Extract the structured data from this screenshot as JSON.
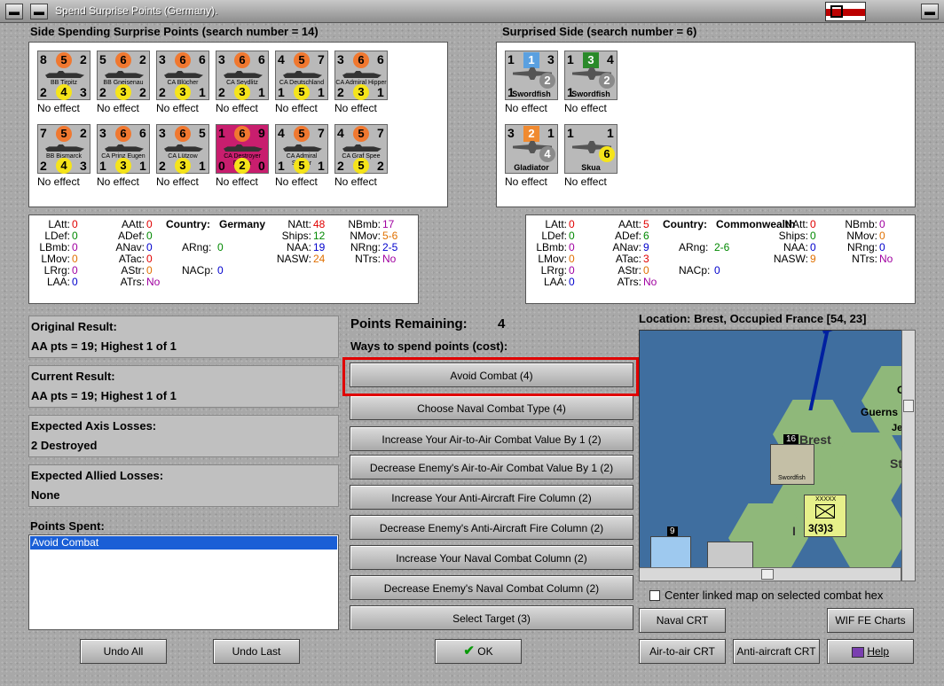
{
  "window": {
    "title": "Spend Surprise Points (Germany)."
  },
  "left_header": "Side Spending Surprise Points (search number = 14)",
  "right_header": "Surprised Side (search number = 6)",
  "left_units": [
    {
      "name": "BB Tirpitz",
      "tl": "8",
      "tc": "5",
      "tr": "2",
      "bl": "2",
      "bc": "4",
      "br": "3",
      "effect": "No effect"
    },
    {
      "name": "BB Gneisenau",
      "tl": "5",
      "tc": "6",
      "tr": "2",
      "bl": "2",
      "bc": "3",
      "br": "2",
      "effect": "No effect"
    },
    {
      "name": "CA Blücher",
      "tl": "3",
      "tc": "6",
      "tr": "6",
      "bl": "2",
      "bc": "3",
      "br": "1",
      "effect": "No effect"
    },
    {
      "name": "CA Seydlitz",
      "tl": "3",
      "tc": "6",
      "tr": "6",
      "bl": "2",
      "bc": "3",
      "br": "1",
      "effect": "No effect"
    },
    {
      "name": "CA Deutschland",
      "tl": "4",
      "tc": "5",
      "tr": "7",
      "bl": "1",
      "bc": "5",
      "br": "1",
      "effect": "No effect"
    },
    {
      "name": "CA Admiral Hipper",
      "tl": "3",
      "tc": "6",
      "tr": "6",
      "bl": "2",
      "bc": "3",
      "br": "1",
      "effect": "No effect"
    },
    {
      "name": "BB Bismarck",
      "tl": "7",
      "tc": "5",
      "tr": "2",
      "bl": "2",
      "bc": "4",
      "br": "3",
      "effect": "No effect"
    },
    {
      "name": "CA Prinz Eugen",
      "tl": "3",
      "tc": "6",
      "tr": "6",
      "bl": "1",
      "bc": "3",
      "br": "1",
      "effect": "No effect"
    },
    {
      "name": "CA Lützow",
      "tl": "3",
      "tc": "6",
      "tr": "5",
      "bl": "2",
      "bc": "3",
      "br": "1",
      "effect": "No effect"
    },
    {
      "name": "CA Destroyer Flotilla",
      "tl": "1",
      "tc": "6",
      "tr": "9",
      "bl": "0",
      "bc": "2",
      "br": "0",
      "effect": "No effect",
      "color": "#c81e6e"
    },
    {
      "name": "CA Admiral Scheer",
      "tl": "4",
      "tc": "5",
      "tr": "7",
      "bl": "1",
      "bc": "5",
      "br": "1",
      "effect": "No effect"
    },
    {
      "name": "CA Graf Spee",
      "tl": "4",
      "tc": "5",
      "tr": "7",
      "bl": "2",
      "bc": "5",
      "br": "2",
      "effect": "No effect"
    }
  ],
  "right_units": [
    {
      "name": "Swordfish",
      "tl": "1",
      "tc": "1",
      "tr": "3",
      "bl": "1",
      "bc": "2",
      "br": "",
      "effect": "No effect",
      "tc_color": "#5aa0e0"
    },
    {
      "name": "Swordfish",
      "tl": "1",
      "tc": "3",
      "tr": "4",
      "bl": "1",
      "bc": "2",
      "br": "",
      "effect": "No effect",
      "tc_color": "#2a8a2a"
    },
    {
      "name": "Gladiator",
      "tl": "3",
      "tc": "2",
      "tr": "1",
      "bl": "",
      "bc": "4",
      "br": "",
      "effect": "No effect",
      "tc_color": "#f08a30"
    },
    {
      "name": "Skua",
      "tl": "1",
      "tc": "",
      "tr": "1",
      "bl": "",
      "bc": "6",
      "br": "",
      "effect": "No effect",
      "tc_color": ""
    }
  ],
  "left_stats": {
    "country_label": "Country:",
    "country": "Germany",
    "rows": [
      [
        [
          "LAtt:",
          "0"
        ],
        [
          "AAtt:",
          "0"
        ],
        [
          "NAtt:",
          "48"
        ],
        [
          "NBmb:",
          "17"
        ]
      ],
      [
        [
          "LDef:",
          "0"
        ],
        [
          "ADef:",
          "0"
        ],
        [
          "Ships:",
          "12"
        ],
        [
          "NMov:",
          "5-6"
        ]
      ],
      [
        [
          "LBmb:",
          "0"
        ],
        [
          "ANav:",
          "0"
        ],
        [
          "NAA:",
          "19"
        ],
        [
          "NRng:",
          "2-5"
        ]
      ],
      [
        [
          "LMov:",
          "0"
        ],
        [
          "ATac:",
          "0"
        ],
        [
          "NASW:",
          "24"
        ],
        [
          "NTrs:",
          "No"
        ]
      ],
      [
        [
          "LRrg:",
          "0"
        ],
        [
          "AStr:",
          "0"
        ]
      ],
      [
        [
          "LAA:",
          "0"
        ],
        [
          "ATrs:",
          "No"
        ]
      ]
    ],
    "arng": [
      "ARng:",
      "0"
    ],
    "nacp": [
      "NACp:",
      "0"
    ]
  },
  "right_stats": {
    "country_label": "Country:",
    "country": "Commonwealth",
    "rows": [
      [
        [
          "LAtt:",
          "0"
        ],
        [
          "AAtt:",
          "5"
        ],
        [
          "NAtt:",
          "0"
        ],
        [
          "NBmb:",
          "0"
        ]
      ],
      [
        [
          "LDef:",
          "0"
        ],
        [
          "ADef:",
          "6"
        ],
        [
          "Ships:",
          "0"
        ],
        [
          "NMov:",
          "0"
        ]
      ],
      [
        [
          "LBmb:",
          "0"
        ],
        [
          "ANav:",
          "9"
        ],
        [
          "NAA:",
          "0"
        ],
        [
          "NRng:",
          "0"
        ]
      ],
      [
        [
          "LMov:",
          "0"
        ],
        [
          "ATac:",
          "3"
        ],
        [
          "NASW:",
          "9"
        ],
        [
          "NTrs:",
          "No"
        ]
      ],
      [
        [
          "LRrg:",
          "0"
        ],
        [
          "AStr:",
          "0"
        ]
      ],
      [
        [
          "LAA:",
          "0"
        ],
        [
          "ATrs:",
          "No"
        ]
      ]
    ],
    "arng": [
      "ARng:",
      "2-6"
    ],
    "nacp": [
      "NACp:",
      "0"
    ]
  },
  "results": {
    "original_label": "Original Result:",
    "original_value": "AA pts = 19; Highest 1 of 1",
    "current_label": "Current Result:",
    "current_value": "AA pts = 19; Highest 1 of 1",
    "axis_label": "Expected Axis Losses:",
    "axis_value": "2 Destroyed",
    "allied_label": "Expected Allied Losses:",
    "allied_value": "None",
    "spent_label": "Points Spent:",
    "spent_items": [
      "Avoid Combat"
    ]
  },
  "points": {
    "label": "Points Remaining:",
    "value": "4",
    "ways_label": "Ways to spend points (cost):"
  },
  "options": [
    "Avoid Combat (4)",
    "Choose Naval Combat Type (4)",
    "Increase Your Air-to-Air Combat Value By 1 (2)",
    "Decrease Enemy's Air-to-Air Combat Value By 1 (2)",
    "Increase Your Anti-Aircraft Fire Column (2)",
    "Decrease Enemy's Anti-Aircraft Fire Column (2)",
    "Increase Your Naval Combat Column (2)",
    "Decrease Enemy's Naval Combat Column (2)",
    "Select Target (3)"
  ],
  "location": {
    "label": "Location: Brest, Occupied France [54, 23]",
    "map_labels": {
      "brest": "Brest",
      "guerns": "Guerns",
      "je": "Je",
      "st": "St",
      "i": "I",
      "c": "C",
      "hexnum": "16",
      "stack": "9",
      "corps": "XXXXX",
      "corps_val": "3(3)3",
      "swordfish": "Swordfish"
    }
  },
  "checkbox_label": "Center linked map on selected combat hex",
  "buttons": {
    "undo_all": "Undo All",
    "undo_last": "Undo Last",
    "ok": "OK",
    "naval_crt": "Naval CRT",
    "wif_charts": "WIF FE Charts",
    "air_crt": "Air-to-air CRT",
    "aa_crt": "Anti-aircraft CRT",
    "help": "Help"
  },
  "colors": {
    "red": "#e00000",
    "green": "#008800",
    "blue": "#0000cc",
    "magenta": "#a000a0",
    "orange": "#e07000",
    "highlight": "#e00000"
  }
}
